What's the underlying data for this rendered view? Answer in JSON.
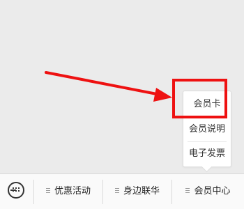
{
  "popup_menu": {
    "items": [
      {
        "label": "会员卡"
      },
      {
        "label": "会员说明"
      },
      {
        "label": "电子发票"
      }
    ]
  },
  "bottom_menu": {
    "keyboard_icon": "keyboard-icon",
    "tabs": [
      {
        "label": "优惠活动",
        "icon": "menu-list-icon"
      },
      {
        "label": "身边联华",
        "icon": "menu-list-icon"
      },
      {
        "label": "会员中心",
        "icon": "menu-list-icon"
      }
    ]
  },
  "annotation": {
    "arrow_color": "#ee1111",
    "highlight_color": "#ee1111"
  }
}
